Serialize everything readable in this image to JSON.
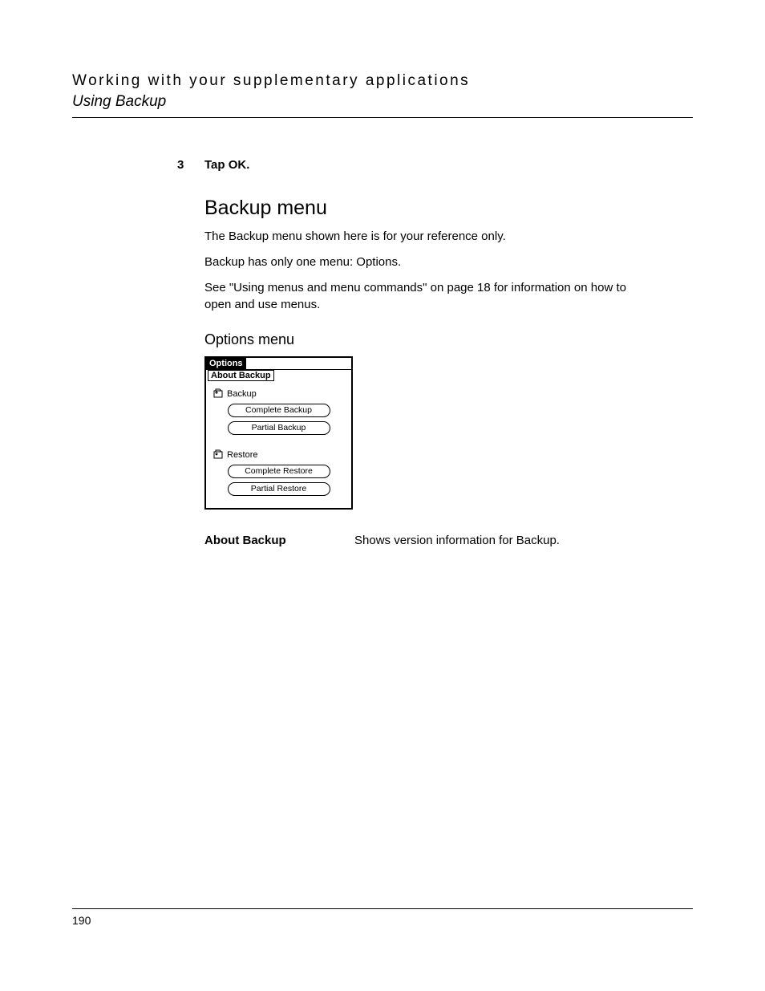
{
  "header": {
    "line1": "Working with your supplementary applications",
    "line2": "Using Backup"
  },
  "step": {
    "num": "3",
    "text": "Tap OK."
  },
  "section_title": "Backup menu",
  "paragraphs": {
    "p1": "The Backup menu shown here is for your reference only.",
    "p2": "Backup has only one menu: Options.",
    "p3": "See \"Using menus and menu commands\" on page 18 for information on how to open and use menus."
  },
  "subsection_title": "Options menu",
  "screenshot": {
    "menubar": "Options",
    "submenu": "About Backup",
    "backup_label": "Backup",
    "restore_label": "Restore",
    "btn_complete_backup": "Complete Backup",
    "btn_partial_backup": "Partial Backup",
    "btn_complete_restore": "Complete Restore",
    "btn_partial_restore": "Partial Restore"
  },
  "definition": {
    "term": "About Backup",
    "desc": "Shows version information for Backup."
  },
  "page_number": "190"
}
